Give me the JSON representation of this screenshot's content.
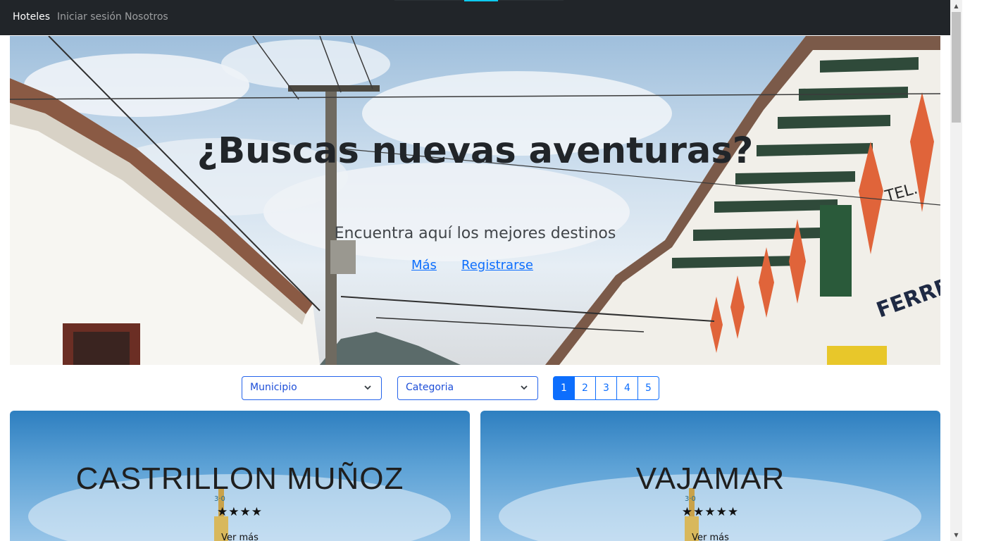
{
  "navbar": {
    "items": [
      {
        "label": "Hoteles",
        "active": true
      },
      {
        "label": "Iniciar sesión",
        "active": false
      },
      {
        "label": "Nosotros",
        "active": false
      }
    ]
  },
  "hero": {
    "title": "¿Buscas nuevas aventuras?",
    "subtitle": "Encuentra aquí los mejores destinos",
    "links": [
      "Más",
      "Registrarse"
    ]
  },
  "filters": {
    "municipio": "Municipio",
    "categoria": "Categoria"
  },
  "pagination": {
    "pages": [
      "1",
      "2",
      "3",
      "4",
      "5"
    ],
    "current": "1"
  },
  "hotels": [
    {
      "name": "CASTRILLON MUÑOZ",
      "stars": "★★★★",
      "rating": 4,
      "more": "Ver más"
    },
    {
      "name": "VAJAMAR",
      "stars": "★★★★★",
      "rating": 5,
      "more": "Ver más"
    }
  ],
  "colors": {
    "navbar_bg": "#212529",
    "accent": "#0d6efd",
    "nav_indicator": "#0dcaf0"
  },
  "icons": {
    "select_chevron": "chevron-down-icon",
    "scroll_up": "scroll-up-arrow-icon",
    "scroll_down": "scroll-down-arrow-icon"
  }
}
